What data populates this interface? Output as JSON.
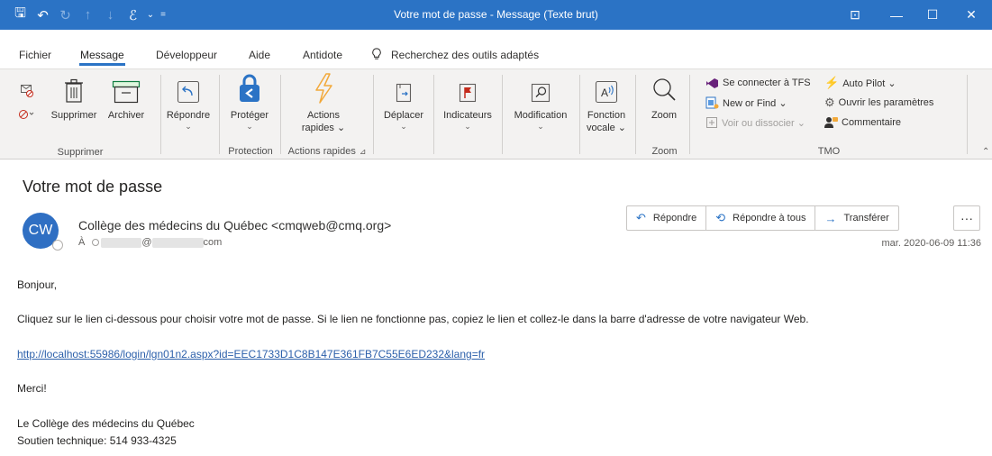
{
  "window": {
    "title": "Votre mot de passe  -  Message (Texte brut)",
    "quick_access": [
      {
        "icon": "save-icon",
        "glyph": "🖫"
      },
      {
        "icon": "undo-icon",
        "glyph": "↶"
      },
      {
        "icon": "redo-icon",
        "glyph": "↻"
      },
      {
        "icon": "up-arrow-icon",
        "glyph": "↑"
      },
      {
        "icon": "down-arrow-icon",
        "glyph": "↓"
      },
      {
        "icon": "rules-icon",
        "glyph": "ℰ"
      },
      {
        "icon": "dropdown-icon",
        "glyph": "⌄"
      },
      {
        "icon": "customize-icon",
        "glyph": "="
      }
    ],
    "controls": [
      {
        "name": "ribbon-display-icon",
        "glyph": "⊡"
      },
      {
        "name": "minimize-icon",
        "glyph": "—"
      },
      {
        "name": "maximize-icon",
        "glyph": "☐"
      },
      {
        "name": "close-icon",
        "glyph": "✕"
      }
    ]
  },
  "menu": {
    "tabs": [
      "Fichier",
      "Message",
      "Développeur",
      "Aide",
      "Antidote"
    ],
    "active_tab": "Message",
    "search": "Recherchez des outils adaptés"
  },
  "ribbon": {
    "supprimer": {
      "label": "Supprimer",
      "delete": "Supprimer",
      "archive": "Archiver"
    },
    "respond": {
      "reply": "Répondre"
    },
    "protection": {
      "label": "Protection",
      "protect": "Protéger"
    },
    "quick_actions": {
      "label": "Actions rapides",
      "actions_line1": "Actions",
      "actions_line2": "rapides ⌄"
    },
    "move": "Déplacer",
    "flags": "Indicateurs",
    "edit": "Modification",
    "voice_line1": "Fonction",
    "voice_line2": "vocale ⌄",
    "zoom": {
      "label": "Zoom",
      "zoom": "Zoom"
    },
    "tmo": {
      "label": "TMO",
      "connect_tfs": "Se connecter à TFS",
      "new_or_find": "New or Find ⌄",
      "view_or_dissociate": "Voir ou dissocier ⌄",
      "auto_pilot": "Auto Pilot ⌄",
      "open_settings": "Ouvrir les paramètres",
      "comment": "Commentaire"
    },
    "colors": {
      "accent": "#2b73c5",
      "lightning": "#f2a93b",
      "flag": "#c42b1c",
      "tfs": "#68217a"
    }
  },
  "message": {
    "subject": "Votre mot de passe",
    "avatar_initials": "CW",
    "sender": "Collège des médecins du Québec <cmqweb@cmq.org>",
    "to_prefix": "À",
    "to_at": "@",
    "to_suffix": "com",
    "date": "mar. 2020-06-09 11:36",
    "actions": {
      "reply": "Répondre",
      "reply_all": "Répondre à tous",
      "forward": "Transférer",
      "more": "···"
    },
    "body": {
      "greeting": "Bonjour,",
      "instruction": "Cliquez sur le lien ci-dessous pour choisir votre mot de passe. Si le lien ne fonctionne pas, copiez le lien et collez-le dans la barre d'adresse de votre navigateur Web.",
      "link": "http://localhost:55986/login/lgn01n2.aspx?id=EEC1733D1C8B147E361FB7C55E6ED232&lang=fr",
      "thanks": "Merci!",
      "signature_line1": "Le Collège des médecins du Québec",
      "signature_line2": "Soutien technique: 514 933-4325"
    }
  }
}
